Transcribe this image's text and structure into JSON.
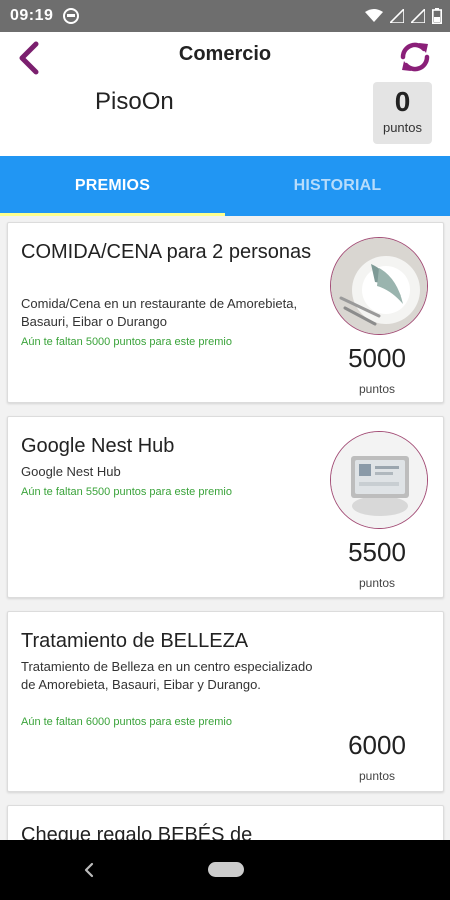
{
  "status_bar": {
    "time": "09:19",
    "icons": [
      "dnd-icon",
      "wifi-icon",
      "signal-icon",
      "signal-icon",
      "battery-icon"
    ]
  },
  "header": {
    "title": "Comercio",
    "shop_name": "PisoOn",
    "points_value": "0",
    "points_label": "puntos",
    "back_icon": "chevron-left-icon",
    "refresh_icon": "refresh-icon"
  },
  "colors": {
    "brand_purple": "#7b1f6e",
    "tab_blue": "#2196f3",
    "tab_indicator": "#ffff8d",
    "missing_green": "#3aa33a"
  },
  "tabs": [
    {
      "label": "PREMIOS",
      "active": true
    },
    {
      "label": "HISTORIAL",
      "active": false
    }
  ],
  "rewards": [
    {
      "title": "COMIDA/CENA para 2 personas",
      "description": "Comida/Cena en un restaurante de Amorebieta, Basauri, Eibar o Durango",
      "missing": "Aún te faltan 5000 puntos para este premio",
      "points": "5000",
      "points_label": "puntos",
      "image": "dinner-plate-image"
    },
    {
      "title": "Google Nest Hub",
      "description": "Google Nest Hub",
      "missing": "Aún te faltan 5500 puntos para este premio",
      "points": "5500",
      "points_label": "puntos",
      "image": "smart-display-image"
    },
    {
      "title": "Tratamiento de BELLEZA",
      "description": "Tratamiento de Belleza en un centro especializado de Amorebieta, Basauri, Eibar y Durango.",
      "missing": "Aún te faltan 6000 puntos para este premio",
      "points": "6000",
      "points_label": "puntos"
    },
    {
      "title": "Cheque regalo BEBÉS de"
    }
  ]
}
